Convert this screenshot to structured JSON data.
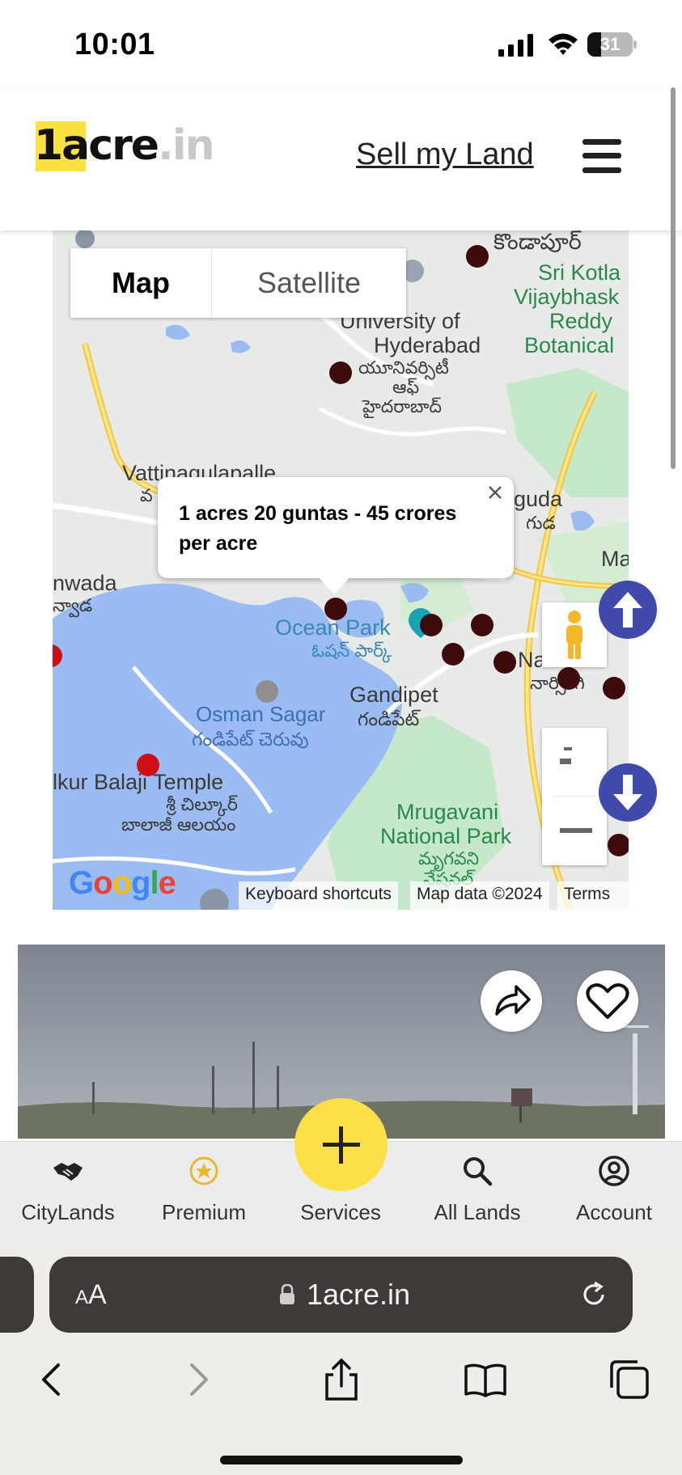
{
  "status_bar": {
    "time": "10:01",
    "battery": "31",
    "battery_level": 0.31
  },
  "header": {
    "logo_main": "1acre",
    "logo_tld": ".in",
    "sell_link": "Sell my Land"
  },
  "map": {
    "type_control": {
      "map_label": "Map",
      "satellite_label": "Satellite",
      "selected": "Map"
    },
    "labels": {
      "kondapur_te": "కొండాపూర్",
      "sri_kotla": "Sri Kotla",
      "vijaybhask": "Vijaybhask",
      "reddy": "Reddy",
      "botanical": "Botanical",
      "university_of": "University of",
      "hyderabad": "Hyderabad",
      "university_te_1": "యూనివర్సిటీ",
      "university_te_2": "ఆఫ్",
      "university_te_3": "హైదరాబాద్",
      "vattinagulapalle": "Vattinagulapalle",
      "vattinagulapalle_te": "వ",
      "nanakramguda": "guda",
      "nanakramguda_te": "గుడ",
      "manikonda": "Ma",
      "khanapur": "nwada",
      "khanapur_te": "న్వాడ",
      "ocean_park": "Ocean Park",
      "ocean_park_te": "ఓషన్ పార్క్",
      "narsingi": "Na",
      "narsingi_te": "నార్సింగి",
      "gandipet": "Gandipet",
      "gandipet_te": "గండిపేట్",
      "osman_sagar": "Osman Sagar",
      "osman_sagar_te": "గండిపేట్ చెరువు",
      "balaji_temple": "lkur Balaji Temple",
      "balaji_te_1": "శ్రీ చిల్కూర్",
      "balaji_te_2": "బాలాజీ ఆలయం",
      "mrugavani": "Mrugavani",
      "national_park": "National Park",
      "mrugavani_te_1": "మృగవని",
      "mrugavani_te_2": "నేషనల్"
    },
    "popup": {
      "text": "1 acres 20 guntas - 45 crores per acre"
    },
    "zoom": {
      "in_label": "-",
      "out_label": "—"
    },
    "attribution": {
      "google": "Google",
      "shortcuts": "Keyboard shortcuts",
      "map_data": "Map data ©2024",
      "terms": "Terms"
    }
  },
  "listing": {
    "share_icon": "share-icon",
    "favorite_icon": "heart-icon"
  },
  "bottom_nav": {
    "items": [
      {
        "label": "CityLands",
        "icon": "handshake-icon"
      },
      {
        "label": "Premium",
        "icon": "star-icon"
      },
      {
        "label": "Services",
        "icon": "plus-icon"
      },
      {
        "label": "All Lands",
        "icon": "search-icon"
      },
      {
        "label": "Account",
        "icon": "account-icon"
      }
    ]
  },
  "browser": {
    "text_size": "AA",
    "url": "1acre.in"
  },
  "colors": {
    "brand_yellow": "#fde047",
    "marker": "#3d0b0b",
    "marker_highlight": "#d00f14",
    "scroll_button": "#3f4aaa",
    "water": "#9bbcf2"
  }
}
